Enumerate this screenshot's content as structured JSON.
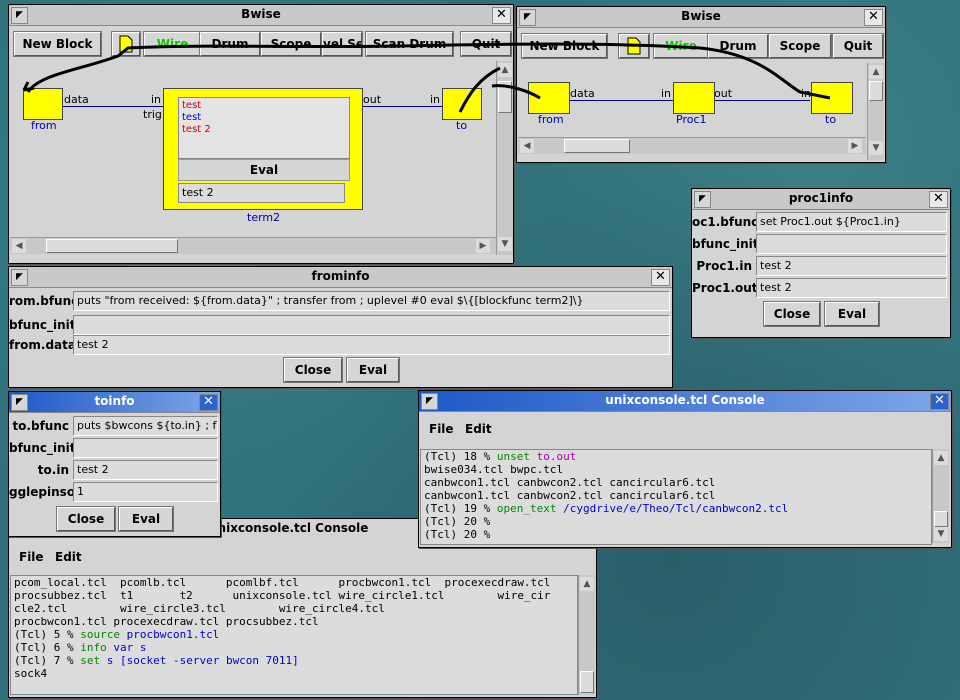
{
  "bwise1": {
    "title": "Bwise",
    "toolbar": [
      "New Block",
      "Wire",
      "Drum",
      "Scope",
      "vel Se",
      "Scan Drum",
      "Quit"
    ],
    "blocks": {
      "from": "from",
      "term2": "term2",
      "to": "to"
    },
    "ports": {
      "data": "data",
      "in": "in",
      "trig": "trig",
      "out": "out",
      "to_in": "in"
    },
    "term2_text": [
      "test",
      "test",
      "test 2"
    ],
    "term2_eval": "Eval",
    "term2_entry": "test 2"
  },
  "bwise2": {
    "title": "Bwise",
    "toolbar": [
      "New Block",
      "Wire",
      "Drum",
      "Scope",
      "Quit"
    ],
    "blocks": {
      "from": "from",
      "proc1": "Proc1",
      "to": "to"
    },
    "ports": {
      "data": "data",
      "in1": "in",
      "out": "out",
      "in2": "in"
    }
  },
  "proc1info": {
    "title": "proc1info",
    "fields": [
      {
        "label": "oc1.bfunc",
        "value": "set Proc1.out ${Proc1.in}"
      },
      {
        "label": "bfunc_init",
        "value": ""
      },
      {
        "label": "Proc1.in",
        "value": "test 2"
      },
      {
        "label": "Proc1.out",
        "value": "test 2"
      }
    ],
    "close": "Close",
    "eval": "Eval"
  },
  "frominfo": {
    "title": "frominfo",
    "fields": [
      {
        "label": "rom.bfunc",
        "value": "puts \"from received: ${from.data}\" ; transfer from ;   uplevel #0 eval $\\{[blockfunc term2]\\}"
      },
      {
        "label": "bfunc_init",
        "value": ""
      },
      {
        "label": "from.data",
        "value": "test 2"
      }
    ],
    "close": "Close",
    "eval": "Eval"
  },
  "toinfo": {
    "title": "toinfo",
    "fields": [
      {
        "label": "to.bfunc",
        "value": "puts $bwcons ${to.in} ; flu"
      },
      {
        "label": "bfunc_init",
        "value": ""
      },
      {
        "label": "to.in",
        "value": "test 2"
      },
      {
        "label": "gglepinson",
        "value": "1"
      }
    ],
    "close": "Close",
    "eval": "Eval"
  },
  "console_right": {
    "title": "unixconsole.tcl Console",
    "menu": [
      "File",
      "Edit"
    ],
    "lines": [
      [
        "(Tcl) 18 % ",
        "unset ",
        "to.out",
        ""
      ],
      [
        "bwise034.tcl bwpc.tcl",
        "",
        "",
        ""
      ],
      [
        "canbwcon1.tcl canbwcon2.tcl cancircular6.tcl",
        "",
        "",
        ""
      ],
      [
        "canbwcon1.tcl canbwcon2.tcl cancircular6.tcl",
        "",
        "",
        ""
      ],
      [
        "(Tcl) 19 % ",
        "open_text ",
        "/cygdrive/e/Theo/Tcl/canbwcon2.tcl",
        ""
      ],
      [
        "(Tcl) 20 %",
        "",
        "",
        ""
      ],
      [
        "(Tcl) 20 %",
        "",
        "",
        ""
      ]
    ]
  },
  "console_left": {
    "title": "unixconsole.tcl Console",
    "menu": [
      "File",
      "Edit"
    ],
    "lines": [
      [
        "pcom_local.tcl  pcomlb.tcl      pcomlbf.tcl      procbwcon1.tcl  procexecdraw.tcl",
        "",
        "",
        ""
      ],
      [
        "procsubbez.tcl  t1       t2      unixconsole.tcl wire_circle1.tcl        wire_cir",
        "",
        "",
        ""
      ],
      [
        "cle2.tcl        wire_circle3.tcl        wire_circle4.tcl",
        "",
        "",
        ""
      ],
      [
        "procbwcon1.tcl procexecdraw.tcl procsubbez.tcl",
        "",
        "",
        ""
      ],
      [
        "(Tcl) 5 % ",
        "source ",
        "procbwcon1.tcl",
        ""
      ],
      [
        "(Tcl) 6 % ",
        "info ",
        "var s",
        ""
      ],
      [
        "(Tcl) 7 % ",
        "set ",
        "s [socket -server bwcon 7011]",
        ""
      ],
      [
        "sock4",
        "",
        "",
        ""
      ]
    ]
  },
  "colors": {
    "block": "#ffff00",
    "wire_btn": "#00cc00",
    "link": "#000080",
    "titlebar_active": "#1d58c7"
  }
}
